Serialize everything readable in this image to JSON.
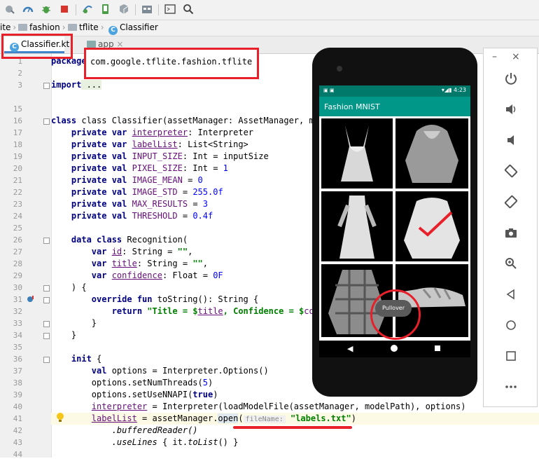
{
  "breadcrumb": {
    "items": [
      "ite",
      "fashion",
      "tflite",
      "Classifier"
    ]
  },
  "tabs": {
    "active": "Classifier.kt",
    "other": "app"
  },
  "package_highlight": "com.google.tflite.fashion.tflite",
  "code": {
    "l1_kw": "package",
    "l3_kw": "import",
    "l3_rest": " ...",
    "l16": "class Classifier(assetManager: AssetManager, modelPat",
    "l16_end": ") {",
    "l17a": "private var ",
    "l17b": "interpreter",
    "l17c": ": Interpreter",
    "l18a": "private var ",
    "l18b": "labelList",
    "l18c": ": List<String>",
    "l19a": "private val ",
    "l19b": "INPUT_SIZE",
    "l19c": ": Int = inputSize",
    "l20a": "private val ",
    "l20b": "PIXEL_SIZE",
    "l20c": ": Int = ",
    "l20d": "1",
    "l21a": "private val ",
    "l21b": "IMAGE_MEAN",
    "l21c": " = ",
    "l21d": "0",
    "l22a": "private val ",
    "l22b": "IMAGE_STD",
    "l22c": " = ",
    "l22d": "255.0f",
    "l23a": "private val ",
    "l23b": "MAX_RESULTS",
    "l23c": " = ",
    "l23d": "3",
    "l24a": "private val ",
    "l24b": "THRESHOLD",
    "l24c": " = ",
    "l24d": "0.4f",
    "l26a": "data class ",
    "l26b": "Recognition(",
    "l27a": "var ",
    "l27b": "id",
    "l27c": ": String = ",
    "l27d": "\"\"",
    "l27e": ",",
    "l28a": "var ",
    "l28b": "title",
    "l28c": ": String = ",
    "l28d": "\"\"",
    "l28e": ",",
    "l29a": "var ",
    "l29b": "confidence",
    "l29c": ": Float = ",
    "l29d": "0F",
    "l30": ") {",
    "l31a": "override fun ",
    "l31b": "toString(): String {",
    "l32a": "return ",
    "l32b": "\"Title = $",
    "l32c": "title",
    "l32d": ", Confidence = $",
    "l32e": "con",
    "l33": "}",
    "l34": "}",
    "l36a": "init",
    "l36b": " {",
    "l37a": "val ",
    "l37b": "options = Interpreter.Options()",
    "l38a": "options.setNumThreads(",
    "l38b": "5",
    "l38c": ")",
    "l39a": "options.setUseNNAPI(",
    "l39b": "true",
    "l39c": ")",
    "l40a": "interpreter",
    "l40b": " = Interpreter(loadModelFile(assetManager, modelPath), options)",
    "l41a": "labelList",
    "l41b": " = assetManager.",
    "l41c": "open",
    "l41d": "(",
    "l41hint": "fileName:",
    "l41e": "\"labels.txt\"",
    "l41f": ")",
    "l42": ".bufferedReader()",
    "l43a": ".useLines",
    "l43b": " { it.",
    "l43c": "toList",
    "l43d": "() }"
  },
  "line_numbers": [
    "1",
    "2",
    "3",
    "15",
    "16",
    "17",
    "18",
    "19",
    "20",
    "21",
    "22",
    "23",
    "24",
    "25",
    "26",
    "27",
    "28",
    "29",
    "30",
    "31",
    "32",
    "33",
    "34",
    "35",
    "36",
    "37",
    "38",
    "39",
    "40",
    "41",
    "42",
    "43",
    "44"
  ],
  "phone": {
    "status_time": "4:23",
    "app_title": "Fashion MNIST",
    "toast": "Pullover"
  },
  "colors": {
    "highlight_red": "#e8202a",
    "app_bar": "#009688",
    "status_bar": "#00796b"
  },
  "emulator_panel": {
    "buttons": [
      "minimize-icon",
      "close-icon",
      "power-icon",
      "volume-up-icon",
      "volume-down-icon",
      "rotate-left-icon",
      "rotate-right-icon",
      "camera-icon",
      "zoom-icon",
      "back-icon",
      "home-icon",
      "overview-icon",
      "more-icon"
    ]
  }
}
